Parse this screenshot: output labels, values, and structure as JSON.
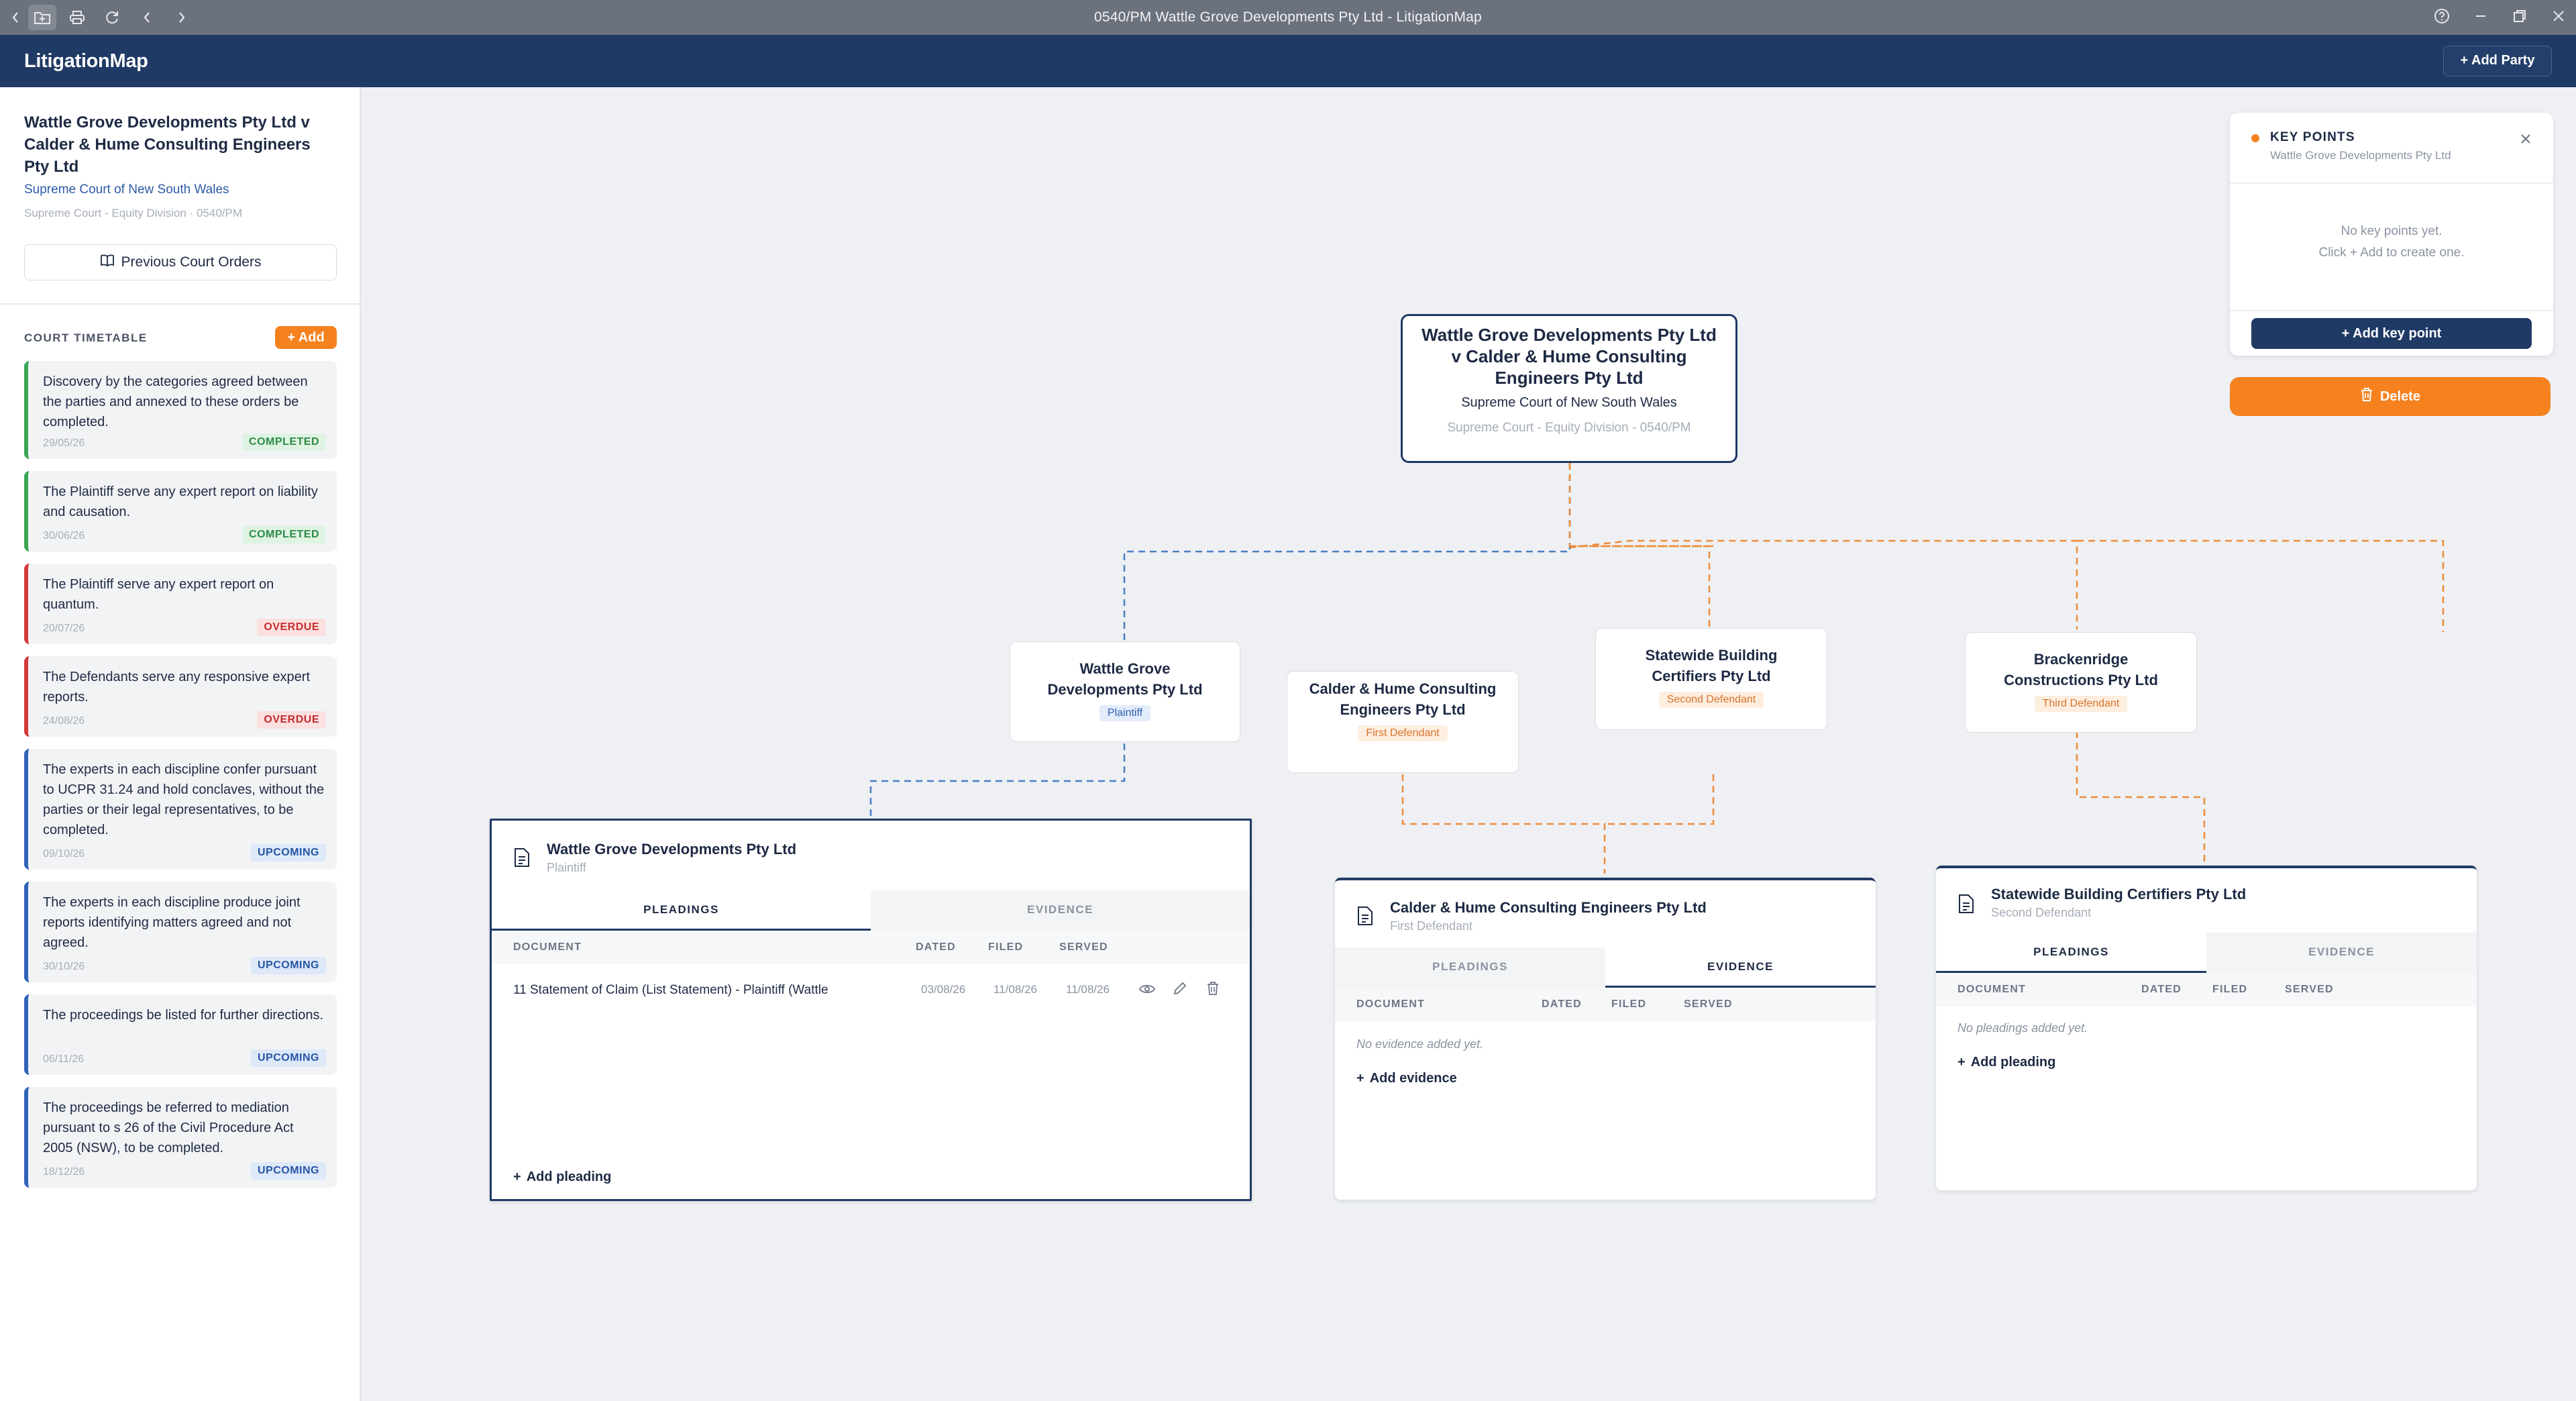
{
  "window": {
    "title": "0540/PM Wattle Grove Developments Pty Ltd - LitigationMap"
  },
  "app": {
    "logo": "LitigationMap",
    "add_party_label": "+ Add Party"
  },
  "sidebar": {
    "case_title": "Wattle Grove Developments Pty Ltd v Calder & Hume Consulting Engineers Pty Ltd",
    "court": "Supreme Court of New South Wales",
    "division": "Supreme Court - Equity Division · 0540/PM",
    "previous_orders_label": "Previous Court Orders",
    "timetable_heading": "COURT TIMETABLE",
    "timetable_add_label": "+ Add",
    "timetable": [
      {
        "text": "Discovery by the categories agreed between the parties and annexed to these orders be completed.",
        "date": "29/05/26",
        "status": "COMPLETED"
      },
      {
        "text": "The Plaintiff serve any expert report on liability and causation.",
        "date": "30/06/26",
        "status": "COMPLETED"
      },
      {
        "text": "The Plaintiff serve any expert report on quantum.",
        "date": "20/07/26",
        "status": "OVERDUE"
      },
      {
        "text": "The Defendants serve any responsive expert reports.",
        "date": "24/08/26",
        "status": "OVERDUE"
      },
      {
        "text": "The experts in each discipline confer pursuant to UCPR 31.24 and hold conclaves, without the parties or their legal representatives, to be completed.",
        "date": "09/10/26",
        "status": "UPCOMING"
      },
      {
        "text": "The experts in each discipline produce joint reports identifying matters agreed and not agreed.",
        "date": "30/10/26",
        "status": "UPCOMING"
      },
      {
        "text": "The proceedings be listed for further directions.",
        "date": "06/11/26",
        "status": "UPCOMING"
      },
      {
        "text": "The proceedings be referred to mediation pursuant to s 26 of the Civil Procedure Act 2005 (NSW), to be completed.",
        "date": "18/12/26",
        "status": "UPCOMING"
      }
    ]
  },
  "root": {
    "title": "Wattle Grove Developments Pty Ltd v Calder & Hume Consulting Engineers Pty Ltd",
    "court": "Supreme Court of New South Wales",
    "division": "Supreme Court - Equity Division - 0540/PM"
  },
  "parties": [
    {
      "name": "Wattle Grove Developments Pty Ltd",
      "role": "Plaintiff"
    },
    {
      "name": "Calder & Hume Consulting Engineers Pty Ltd",
      "role": "First Defendant"
    },
    {
      "name": "Statewide Building Certifiers Pty Ltd",
      "role": "Second Defendant"
    },
    {
      "name": "Brackenridge Constructions Pty Ltd",
      "role": "Third Defendant"
    }
  ],
  "panels": {
    "columns": {
      "document": "DOCUMENT",
      "dated": "DATED",
      "filed": "FILED",
      "served": "SERVED"
    },
    "tabs": {
      "pleadings": "PLEADINGS",
      "evidence": "EVIDENCE"
    },
    "plaintiff": {
      "name": "Wattle Grove Developments Pty Ltd",
      "role": "Plaintiff",
      "active_tab": "PLEADINGS",
      "rows": [
        {
          "document": "11 Statement of Claim (List Statement) - Plaintiff (Wattle",
          "dated": "03/08/26",
          "filed": "11/08/26",
          "served": "11/08/26"
        }
      ],
      "add_label": "Add pleading"
    },
    "first_defendant": {
      "name": "Calder & Hume Consulting Engineers Pty Ltd",
      "role": "First Defendant",
      "active_tab": "EVIDENCE",
      "empty_text": "No evidence added yet.",
      "add_label": "Add evidence"
    },
    "second_defendant": {
      "name": "Statewide Building Certifiers Pty Ltd",
      "role": "Second Defendant",
      "active_tab": "PLEADINGS",
      "empty_text": "No pleadings added yet.",
      "add_label": "Add pleading"
    }
  },
  "key_points": {
    "title": "KEY POINTS",
    "subtitle": "Wattle Grove Developments Pty Ltd",
    "empty_line1": "No key points yet.",
    "empty_line2": "Click + Add to create one.",
    "add_label": "+ Add key point",
    "delete_label": "Delete"
  },
  "colors": {
    "navy": "#1f3a64",
    "orange": "#f5821f",
    "completed": "#3aa655",
    "overdue": "#d43a3a",
    "upcoming": "#2f64b8"
  }
}
